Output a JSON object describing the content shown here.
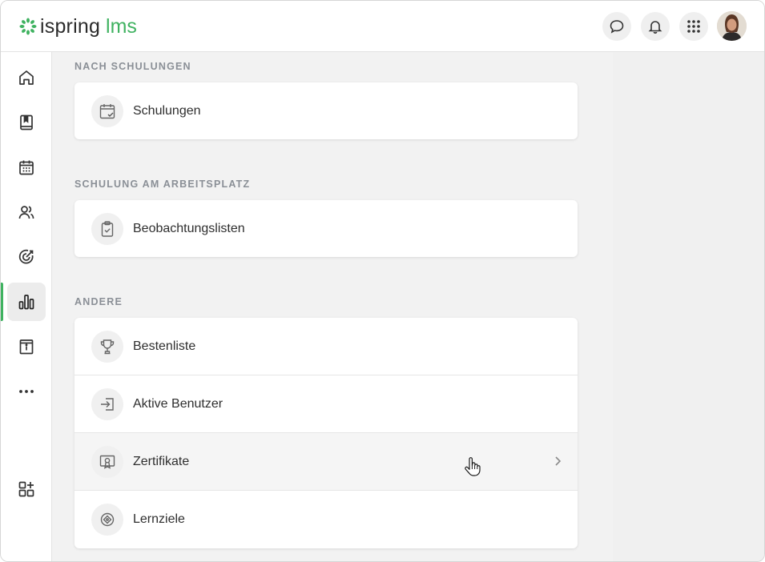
{
  "brand": {
    "name": "ispring",
    "product": "lms",
    "accent_color": "#3fb260"
  },
  "header": {
    "buttons": [
      {
        "icon": "chat-icon"
      },
      {
        "icon": "bell-icon"
      },
      {
        "icon": "apps-grid-icon"
      },
      {
        "icon": "user-avatar"
      }
    ]
  },
  "sidebar": {
    "items": [
      {
        "icon": "home-icon",
        "active": false
      },
      {
        "icon": "book-icon",
        "active": false
      },
      {
        "icon": "calendar-icon",
        "active": false
      },
      {
        "icon": "users-icon",
        "active": false
      },
      {
        "icon": "target-icon",
        "active": false
      },
      {
        "icon": "reports-chart-icon",
        "active": true
      },
      {
        "icon": "info-box-icon",
        "active": false
      },
      {
        "icon": "more-icon",
        "active": false
      },
      {
        "icon": "add-widget-icon",
        "active": false
      }
    ]
  },
  "sections": [
    {
      "title": "NACH SCHULUNGEN",
      "items": [
        {
          "label": "Schulungen",
          "icon": "calendar-check-icon"
        }
      ]
    },
    {
      "title": "SCHULUNG AM ARBEITSPLATZ",
      "items": [
        {
          "label": "Beobachtungslisten",
          "icon": "clipboard-check-icon"
        }
      ]
    },
    {
      "title": "ANDERE",
      "items": [
        {
          "label": "Bestenliste",
          "icon": "trophy-icon"
        },
        {
          "label": "Aktive Benutzer",
          "icon": "login-icon"
        },
        {
          "label": "Zertifikate",
          "icon": "certificate-icon",
          "hovered": true
        },
        {
          "label": "Lernziele",
          "icon": "goal-icon"
        }
      ]
    }
  ]
}
